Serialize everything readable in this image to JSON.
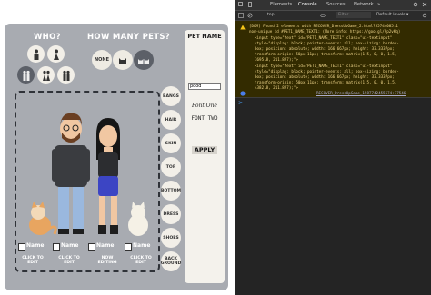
{
  "game": {
    "who_title": "WHO?",
    "how_many_title": "HOW MANY PETS?",
    "pet_counts": [
      "NONE",
      "",
      ""
    ],
    "side_buttons": [
      "BANGS",
      "HAIR",
      "SKIN",
      "TOP",
      "BOTTOM",
      "DRESS",
      "SHOES",
      "BACK GROUND"
    ],
    "name_panel": {
      "title": "PET NAME",
      "input_value": "pood",
      "font_one": "Font One",
      "font_two": "FONT TWO",
      "apply": "APPLY"
    },
    "slots": [
      {
        "name": "Name",
        "caption": "CLICK TO EDIT"
      },
      {
        "name": "Name",
        "caption": "CLICK TO EDIT"
      },
      {
        "name": "Name",
        "caption": "NOW EDITING"
      },
      {
        "name": "Name",
        "caption": "CLICK TO EDIT"
      }
    ]
  },
  "devtools": {
    "tabs": [
      "Elements",
      "Console",
      "Sources",
      "Network"
    ],
    "more": "»",
    "context": "top",
    "filter_placeholder": "Filter",
    "levels": "Default levels ▾",
    "messages": [
      "[DOM] Found 2 elements with   RECOVER_DressUpGame_2.html?55744085:1",
      "non-unique id #PET1_NAME_TEXT1: (More info: https://goo.gl/9p2vKq)",
      "<input type=\"text\" id=\"PET1_NAME_TEXT1\" class=\"ui-textinput\"",
      "style=\"display: block; pointer-events: all; box-sizing: border-",
      "box; position: absolute; width: 166.667px; height: 33.3337px;",
      "transform-origin: 50px 11px; transform: matrix(1.5, 0, 0, 1.5,",
      "3695.8, 211.897);\">",
      "<input type=\"text\" id=\"PET1_NAME_TEXT1\" class=\"ui-textinput\"",
      "style=\"display: block; pointer-events: all; box-sizing: border-",
      "box; position: absolute; width: 166.667px; height: 33.3337px;",
      "transform-origin: 50px 11px; transform: matrix(1.5, 0, 0, 1.5,",
      "4382.8, 211.897);\">"
    ],
    "second_source": "RECOVER_DressUpGame_1587742455674:17546",
    "prompt": ">"
  }
}
